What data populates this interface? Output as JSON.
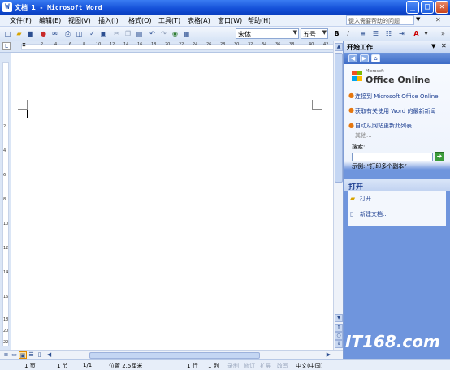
{
  "window": {
    "title": "文档 1 - Microsoft Word",
    "minimize": "_",
    "maximize": "□",
    "close": "✕"
  },
  "menu": {
    "items": [
      "文件(F)",
      "编辑(E)",
      "视图(V)",
      "插入(I)",
      "格式(O)",
      "工具(T)",
      "表格(A)",
      "窗口(W)",
      "帮助(H)"
    ],
    "ask_placeholder": "键入需要帮助的问题"
  },
  "toolbar": {
    "font": "宋体",
    "size": "五号",
    "bold": "B",
    "italic": "I",
    "font_color_label": "A"
  },
  "ruler": {
    "numbers": [
      "2",
      "4",
      "6",
      "8",
      "10",
      "12",
      "14",
      "16",
      "18",
      "20",
      "22",
      "24",
      "26",
      "28",
      "30",
      "32",
      "34",
      "36",
      "38",
      "40",
      "42"
    ],
    "vnumbers": [
      "2",
      "4",
      "6",
      "8",
      "10",
      "12",
      "14",
      "16",
      "18",
      "20",
      "22"
    ]
  },
  "taskpane": {
    "title": "开始工作",
    "office_online": "Office Online",
    "office_micro": "Microsoft",
    "links": [
      "连接到 Microsoft Office Online",
      "获取有关使用 Word 的最新新闻",
      "自动从网站更新此列表"
    ],
    "more": "其他...",
    "search_label": "搜索:",
    "example": "示例: “打印多个副本”",
    "open_header": "打开",
    "open_link": "打开...",
    "new_doc": "新建文档..."
  },
  "status": {
    "page": "1 页",
    "section": "1 节",
    "pages": "1/1",
    "position": "位置 2.5厘米",
    "line": "1 行",
    "col": "1 列",
    "rec": "录制",
    "trk": "修订",
    "ext": "扩展",
    "ovr": "改写",
    "lang": "中文(中国)"
  },
  "watermark": "IT168.com",
  "colors": {
    "title_bar": "#1450d8",
    "task_pane_accent": "#6f95dd",
    "bullet": "#e5770f"
  }
}
